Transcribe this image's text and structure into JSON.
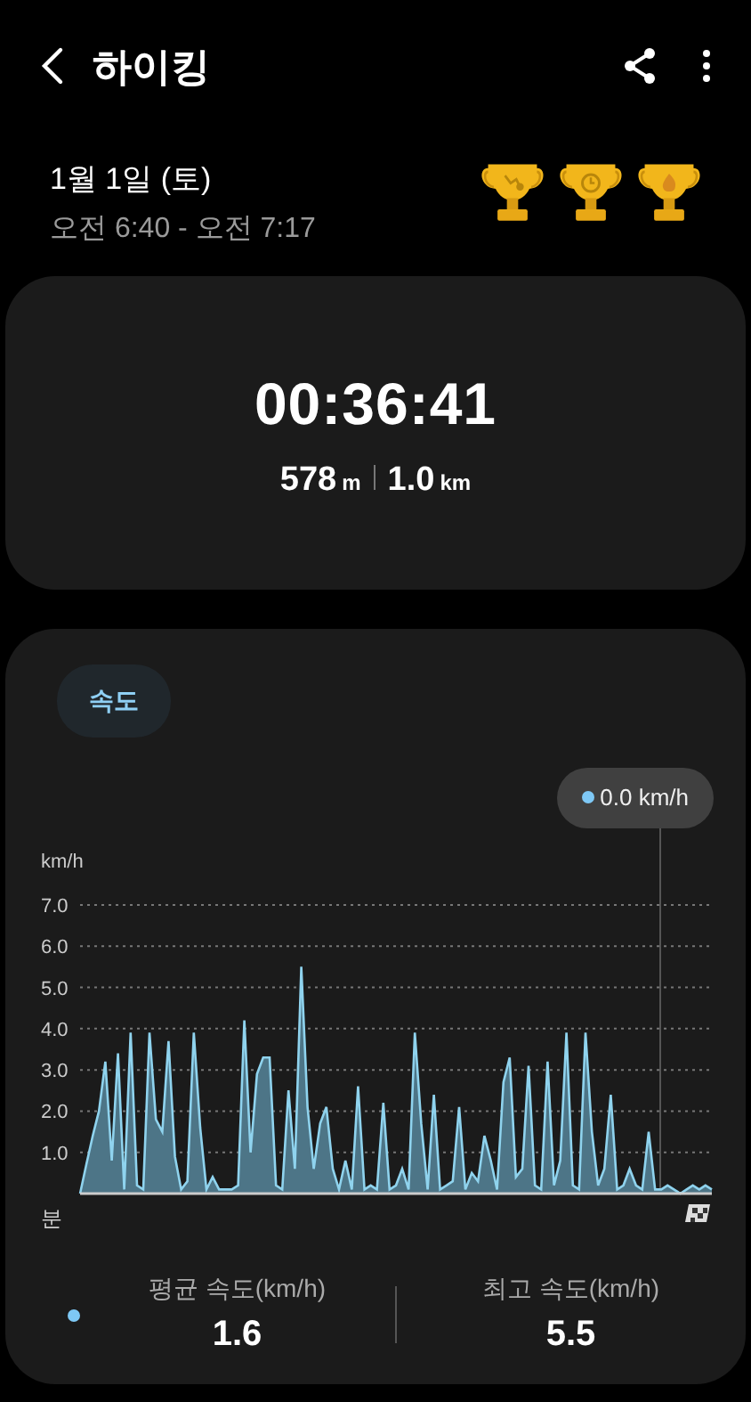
{
  "header": {
    "title": "하이킹"
  },
  "summary": {
    "date": "1월 1일 (토)",
    "time_range": "오전 6:40 - 오전 7:17"
  },
  "workout": {
    "duration": "00:36:41",
    "distance_m": "578",
    "distance_m_unit": "m",
    "distance_km": "1.0",
    "distance_km_unit": "km"
  },
  "speed": {
    "filters": [
      {
        "label": "속도",
        "selected": true
      }
    ],
    "tooltip": {
      "value": "0.0 km/h"
    },
    "chart_data": {
      "type": "area",
      "grid": true,
      "xlabel": "분",
      "ylabel": "km/h",
      "ylim": [
        0,
        7
      ],
      "yticks": [
        {
          "value": 1,
          "label": "1.0"
        },
        {
          "value": 2,
          "label": "2.0"
        },
        {
          "value": 3,
          "label": "3.0"
        },
        {
          "value": 4,
          "label": "4.0"
        },
        {
          "value": 5,
          "label": "5.0"
        },
        {
          "value": 6,
          "label": "6.0"
        },
        {
          "value": 7,
          "label": "7.0"
        }
      ],
      "values": [
        0,
        0.7,
        1.4,
        2.0,
        3.2,
        0.8,
        3.4,
        0.1,
        3.9,
        0.2,
        0.1,
        3.9,
        1.8,
        1.5,
        3.7,
        0.9,
        0.1,
        0.3,
        3.9,
        1.6,
        0.1,
        0.4,
        0.1,
        0.1,
        0.1,
        0.2,
        4.2,
        1.0,
        2.9,
        3.3,
        3.3,
        0.2,
        0.1,
        2.5,
        0.6,
        5.5,
        2.1,
        0.6,
        1.7,
        2.1,
        0.6,
        0.1,
        0.8,
        0.1,
        2.6,
        0.1,
        0.2,
        0.1,
        2.2,
        0.1,
        0.2,
        0.6,
        0.1,
        3.9,
        1.7,
        0.1,
        2.4,
        0.1,
        0.2,
        0.3,
        2.1,
        0.1,
        0.5,
        0.3,
        1.4,
        0.8,
        0.1,
        2.7,
        3.3,
        0.4,
        0.6,
        3.1,
        0.2,
        0.1,
        3.2,
        0.2,
        0.8,
        3.9,
        0.2,
        0.1,
        3.9,
        1.5,
        0.2,
        0.6,
        2.4,
        0.1,
        0.2,
        0.6,
        0.2,
        0.1,
        1.5,
        0.1,
        0.1,
        0.2,
        0.1,
        0,
        0.1,
        0.2,
        0.1,
        0.2,
        0.1
      ]
    },
    "stats": [
      {
        "label": "평균 속도(km/h)",
        "value": "1.6"
      },
      {
        "label": "최고 속도(km/h)",
        "value": "5.5"
      }
    ]
  }
}
